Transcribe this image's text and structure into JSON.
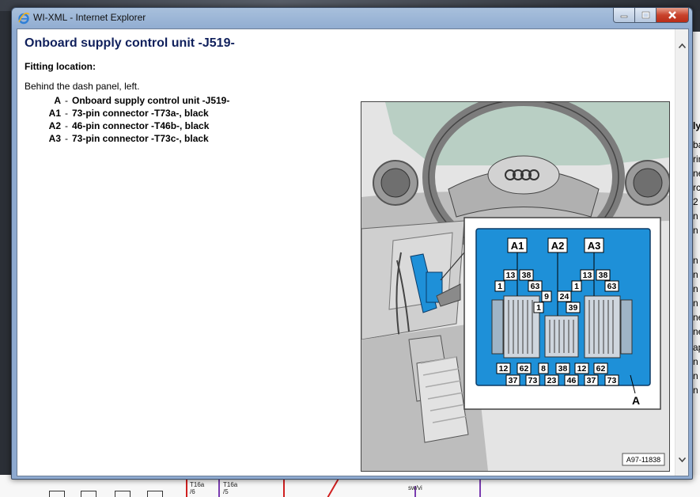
{
  "window": {
    "title": "WI-XML - Internet Explorer"
  },
  "document": {
    "heading": "Onboard supply control unit -J519-",
    "subheading": "Fitting location:",
    "location_text": "Behind the dash panel, left.",
    "legend": [
      {
        "key": "A",
        "label": "Onboard supply control unit -J519-"
      },
      {
        "key": "A1",
        "label": "73-pin connector -T73a-, black"
      },
      {
        "key": "A2",
        "label": "46-pin connector -T46b-, black"
      },
      {
        "key": "A3",
        "label": "73-pin connector -T73c-, black"
      }
    ]
  },
  "figure": {
    "connector_labels": [
      "A1",
      "A2",
      "A3"
    ],
    "unit_label": "A",
    "pins_a1_top": [
      "13",
      "38",
      "1",
      "63"
    ],
    "pins_a2_top": [
      "9",
      "24",
      "1",
      "39"
    ],
    "pins_a3_top": [
      "13",
      "38",
      "1",
      "63"
    ],
    "pins_bottom_row1": [
      "12",
      "62",
      "8",
      "38",
      "12",
      "62"
    ],
    "pins_bottom_row2": [
      "37",
      "73",
      "23",
      "46",
      "37",
      "73"
    ],
    "image_id": "A97-11838"
  },
  "background": {
    "right_fragments": [
      "ly",
      "ba",
      "rir",
      "ne",
      "rc",
      "2",
      "n",
      "n",
      "n",
      "n",
      "n",
      "n",
      "ne",
      "ne",
      "ap",
      "n",
      "n",
      "n"
    ],
    "bottom_labels": [
      "T16a",
      "/6",
      "T16a",
      "/5",
      "sw/vi"
    ]
  },
  "colors": {
    "heading": "#10205c",
    "control_unit_blue": "#1e90d8"
  }
}
